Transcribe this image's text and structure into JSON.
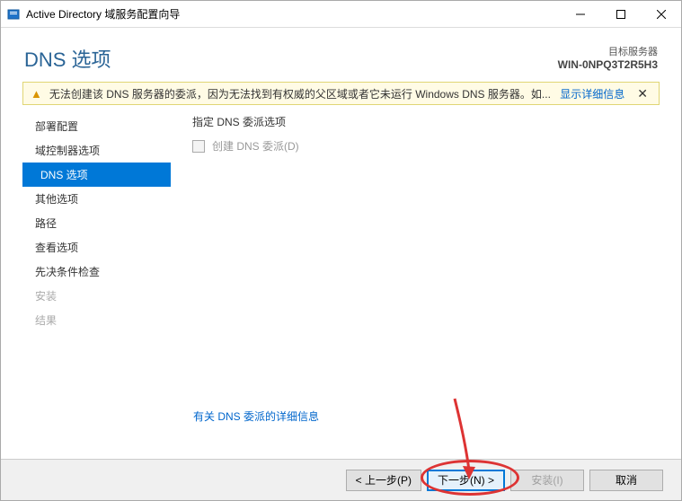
{
  "titlebar": {
    "title": "Active Directory 域服务配置向导"
  },
  "header": {
    "page_title": "DNS 选项",
    "target_label": "目标服务器",
    "target_server": "WIN-0NPQ3T2R5H3"
  },
  "warning": {
    "text": "无法创建该 DNS 服务器的委派，因为无法找到有权威的父区域或者它未运行 Windows DNS 服务器。如...",
    "link": "显示详细信息"
  },
  "sidebar": {
    "items": [
      {
        "label": "部署配置",
        "state": "normal"
      },
      {
        "label": "域控制器选项",
        "state": "normal"
      },
      {
        "label": "DNS 选项",
        "state": "active"
      },
      {
        "label": "其他选项",
        "state": "normal"
      },
      {
        "label": "路径",
        "state": "normal"
      },
      {
        "label": "查看选项",
        "state": "normal"
      },
      {
        "label": "先决条件检查",
        "state": "normal"
      },
      {
        "label": "安装",
        "state": "disabled"
      },
      {
        "label": "结果",
        "state": "disabled"
      }
    ]
  },
  "content": {
    "section_title": "指定 DNS 委派选项",
    "checkbox_label": "创建 DNS 委派(D)"
  },
  "links": {
    "more_info": "有关 DNS 委派的详细信息"
  },
  "footer": {
    "prev": "< 上一步(P)",
    "next": "下一步(N) >",
    "install": "安装(I)",
    "cancel": "取消"
  }
}
